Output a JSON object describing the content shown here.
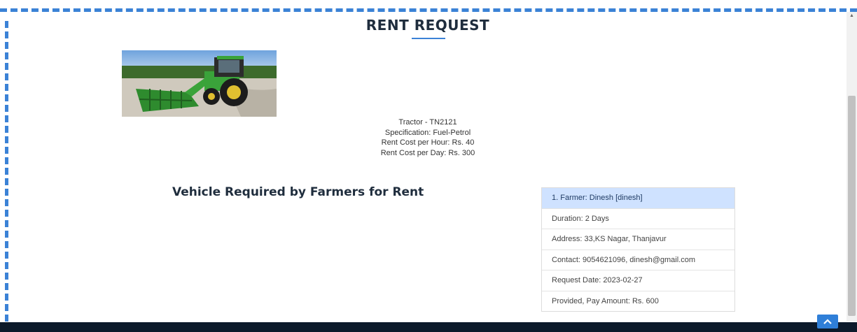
{
  "page": {
    "title": "RENT REQUEST"
  },
  "vehicle": {
    "image_alt": "green tractor with front loader",
    "name": "Tractor - TN2121",
    "specification": "Specification: Fuel-Petrol",
    "rent_per_hour": "Rent Cost per Hour: Rs. 40",
    "rent_per_day": "Rent Cost per Day: Rs. 300"
  },
  "requests_section": {
    "title": "Vehicle Required by Farmers for Rent",
    "items": [
      "1. Farmer: Dinesh [dinesh]",
      "Duration: 2 Days",
      "Address: 33,KS Nagar, Thanjavur",
      "Contact: 9054621096, dinesh@gmail.com",
      "Request Date: 2023-02-27",
      "Provided, Pay Amount: Rs. 600"
    ]
  },
  "icons": {
    "back_to_top": "chevron-up-icon",
    "scroll_up": "scroll-up-arrow-icon",
    "scroll_down": "scroll-down-arrow-icon"
  },
  "colors": {
    "accent": "#3b82d6",
    "highlight_item": "#cfe2ff",
    "footer": "#0c1a2b",
    "back_to_top_button": "#2f7fd8"
  }
}
